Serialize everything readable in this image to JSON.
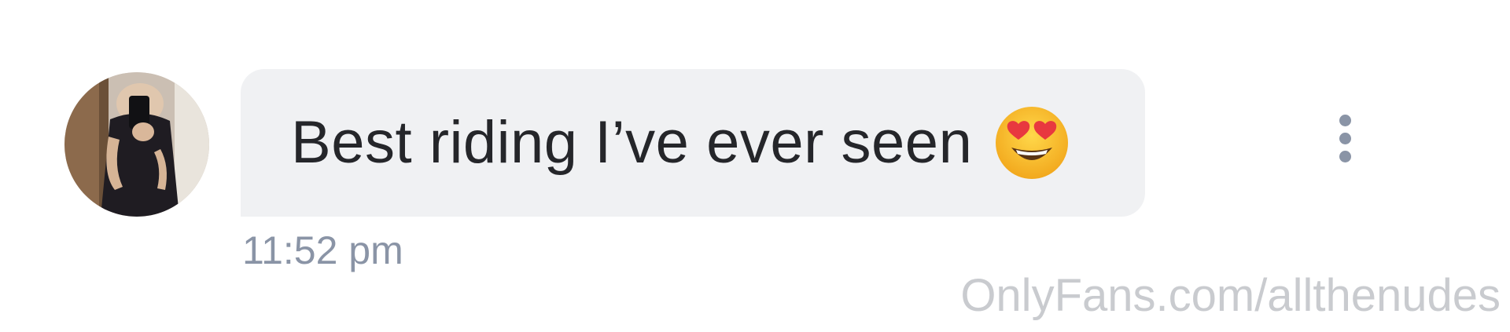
{
  "message": {
    "text": "Best riding I’ve ever seen",
    "emoji_icon": "heart-eyes-emoji",
    "timestamp": "11:52 pm"
  },
  "avatar": {
    "icon": "user-avatar-photo"
  },
  "actions": {
    "more_icon": "vertical-dots-icon"
  },
  "watermark": {
    "text": "OnlyFans.com/allthenudes"
  },
  "colors": {
    "bubble_background": "#f0f1f3",
    "message_text": "#25262a",
    "timestamp_text": "#8a94a6",
    "watermark_text": "#c9cbcf"
  }
}
